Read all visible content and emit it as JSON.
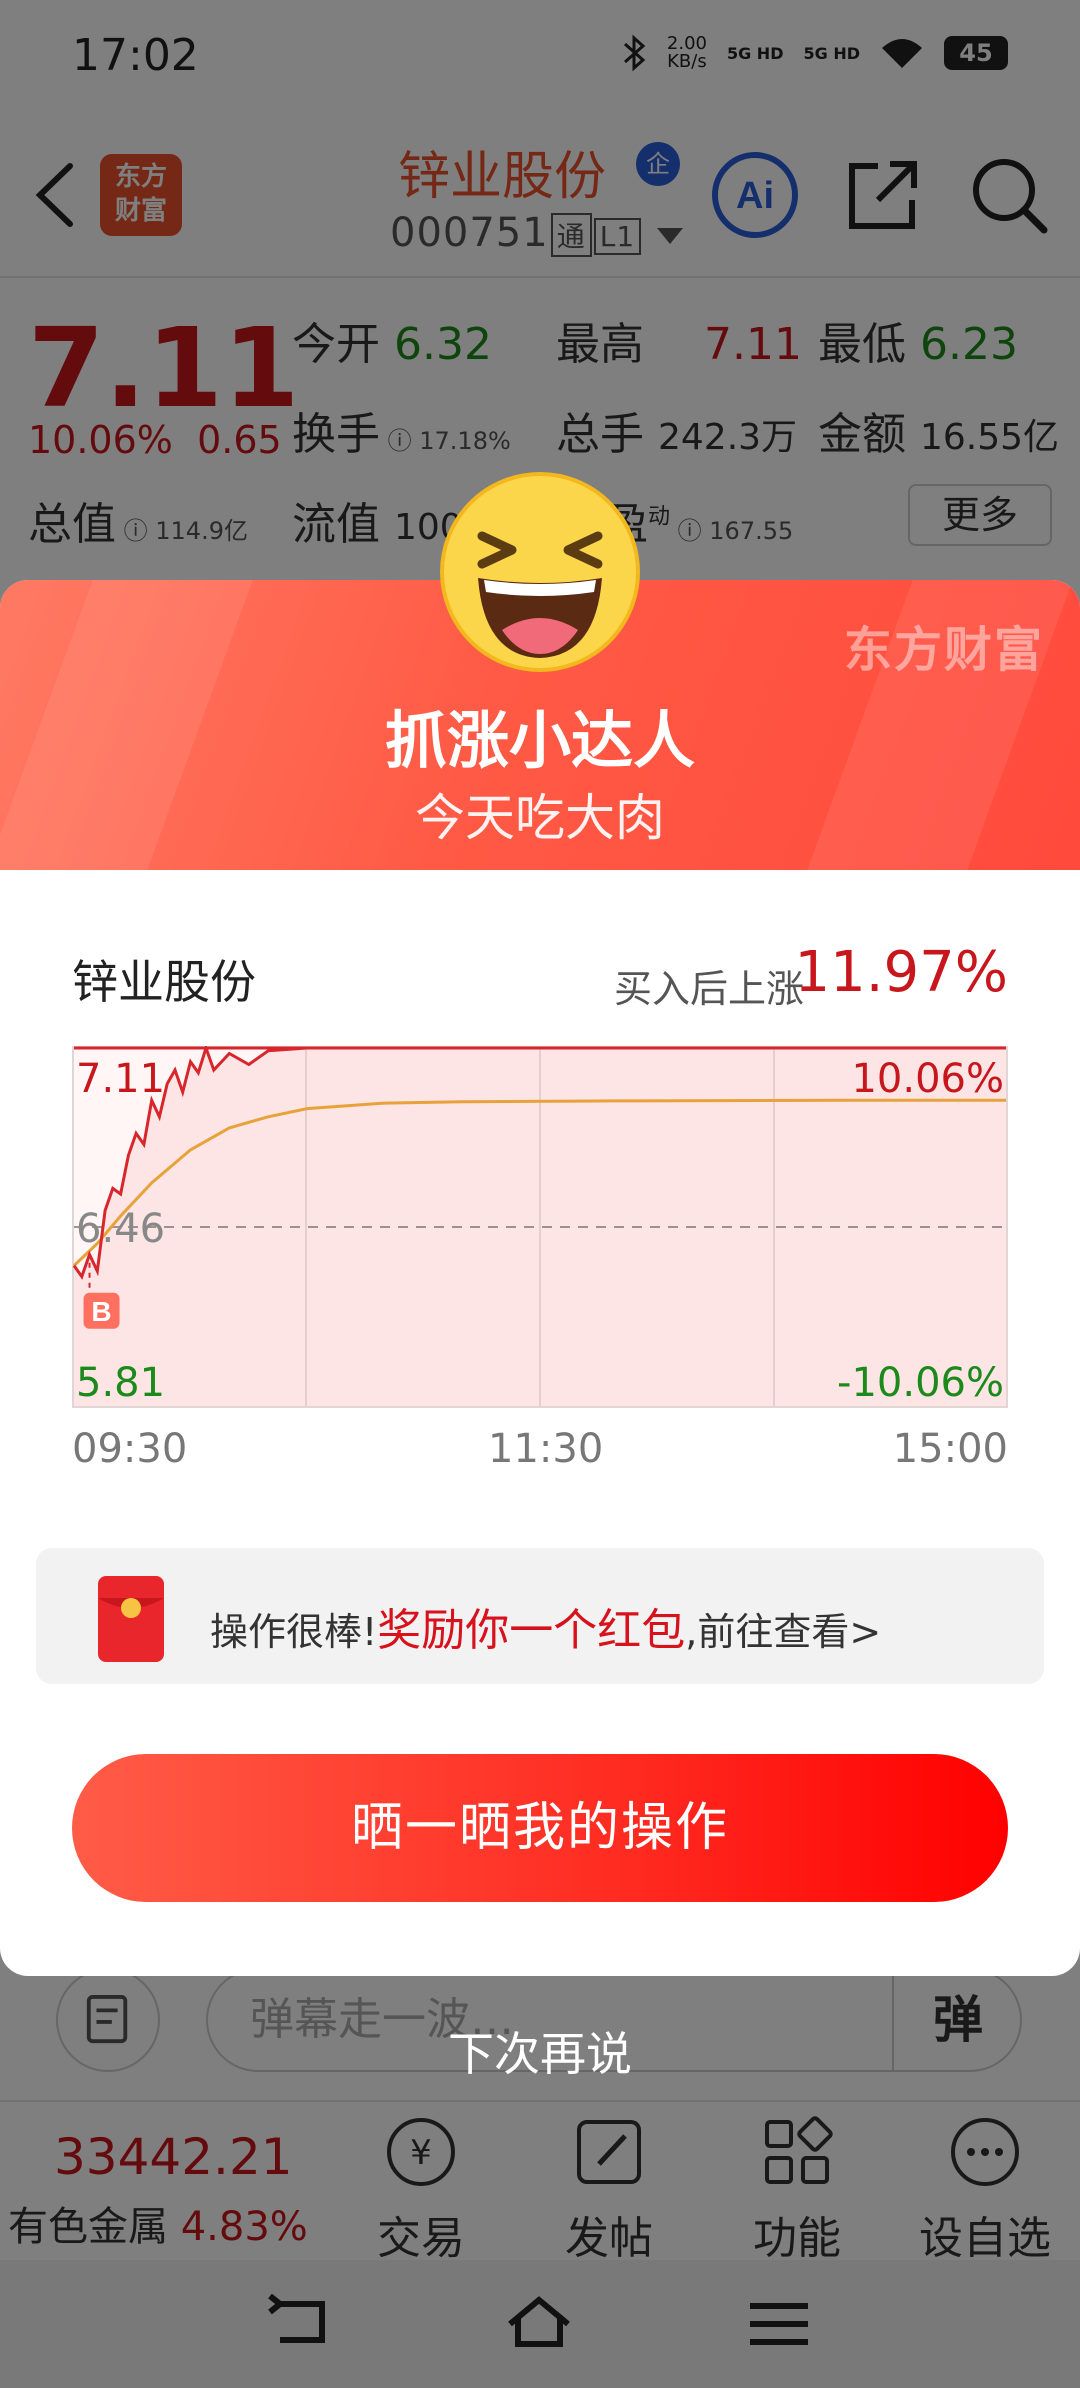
{
  "status_bar": {
    "time": "17:02",
    "net_speed_value": "2.00",
    "net_speed_unit": "KB/s",
    "sig1": "5G HD",
    "sig2": "5G HD",
    "battery": "45"
  },
  "header": {
    "logo_line1": "东方",
    "logo_line2": "财富",
    "stock_name": "锌业股份",
    "qi_badge": "企",
    "stock_code": "000751",
    "connect_tag": "通",
    "level_tag": "L1"
  },
  "quote": {
    "price": "7.11",
    "change_pct": "10.06%",
    "change_amt": "0.65",
    "open_label": "今开",
    "open": "6.32",
    "high_label": "最高",
    "high": "7.11",
    "low_label": "最低",
    "low": "6.23",
    "turnover_label": "换手",
    "turnover": "17.18%",
    "volume_label": "总手",
    "volume": "242.3万",
    "amount_label": "金额",
    "amount": "16.55亿",
    "total_value_label": "总值",
    "total_value": "114.9亿",
    "float_value_label": "流值",
    "float_value": "100",
    "pe_label": "盈",
    "pe_sup": "动",
    "pe": "167.55",
    "more": "更多"
  },
  "popup": {
    "brand": "东方财富",
    "title": "抓涨小达人",
    "subtitle": "今天吃大肉",
    "stock_name": "锌业股份",
    "gain_label": "买入后上涨",
    "gain_value": "11.97%",
    "buy_marker": "B",
    "reward_prefix": "操作很棒!",
    "reward_highlight": "奖励你一个红包",
    "reward_suffix": ",前往查看>",
    "share_button": "晒一晒我的操作",
    "skip": "下次再说"
  },
  "chart_data": {
    "type": "line",
    "x_ticks": [
      "09:30",
      "11:30",
      "15:00"
    ],
    "y_max_label": "7.11",
    "y_mid_label": "6.46",
    "y_min_label": "5.81",
    "pct_max_label": "10.06%",
    "pct_min_label": "-10.06%",
    "ylim": [
      5.81,
      7.11
    ],
    "baseline": 6.46,
    "grid": true,
    "series": [
      {
        "role": "price",
        "color": "#d8262c",
        "x": [
          0,
          2,
          4,
          6,
          8,
          10,
          12,
          14,
          16,
          18,
          20,
          22,
          24,
          26,
          28,
          30,
          32,
          34,
          36,
          40,
          45,
          50,
          60,
          80,
          120,
          160,
          240
        ],
        "values": [
          6.32,
          6.28,
          6.36,
          6.3,
          6.52,
          6.6,
          6.58,
          6.72,
          6.8,
          6.76,
          6.92,
          6.86,
          6.98,
          7.03,
          6.95,
          7.06,
          7.02,
          7.11,
          7.03,
          7.09,
          7.05,
          7.1,
          7.11,
          7.11,
          7.11,
          7.11,
          7.11
        ]
      },
      {
        "role": "average",
        "color": "#e8a23a",
        "x": [
          0,
          6,
          12,
          20,
          30,
          40,
          50,
          60,
          80,
          100,
          140,
          200,
          240
        ],
        "values": [
          6.32,
          6.4,
          6.5,
          6.62,
          6.74,
          6.82,
          6.86,
          6.89,
          6.91,
          6.915,
          6.918,
          6.92,
          6.92
        ]
      }
    ],
    "buy_point": {
      "x": 4,
      "value": 6.33
    }
  },
  "bottom": {
    "index_value": "33442.21",
    "index_name": "有色金属",
    "index_change": "4.83%",
    "tabs": [
      "交易",
      "发帖",
      "功能",
      "设自选"
    ],
    "danmu_placeholder": "弹幕走一波…",
    "danmu_button": "弹"
  },
  "colors": {
    "up": "#c8161d",
    "down": "#1b8a1b",
    "accent": "#ff4a3c",
    "brand": "#e8512b"
  }
}
